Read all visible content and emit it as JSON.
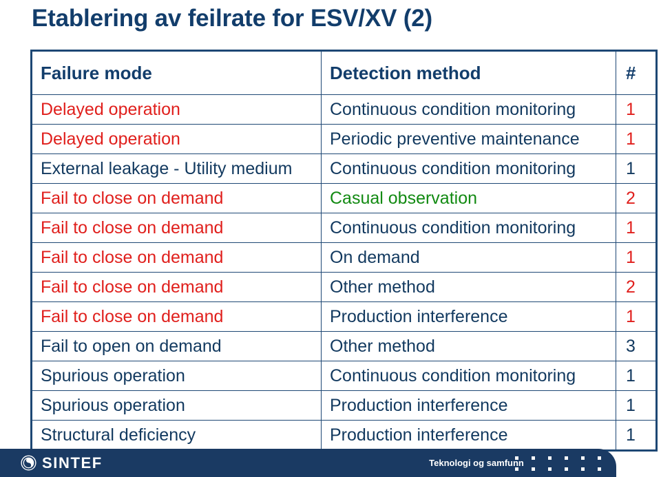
{
  "slide": {
    "title": "Etablering av feilrate for ESV/XV (2)",
    "title_color": "#123d6b"
  },
  "colors": {
    "navy": "#123d6b",
    "body_navy": "#12395f",
    "red": "#e01f1c",
    "green": "#128a12",
    "footer_bar": "#1a3a63",
    "border": "#1d4774"
  },
  "table": {
    "headers": {
      "failure_mode": "Failure mode",
      "detection_method": "Detection method",
      "count": "#"
    },
    "rows": [
      {
        "mode": "Delayed operation",
        "mode_color": "red",
        "method": "Continuous condition monitoring",
        "method_color": "blue",
        "count": "1",
        "count_color": "red"
      },
      {
        "mode": "Delayed operation",
        "mode_color": "red",
        "method": "Periodic preventive maintenance",
        "method_color": "blue",
        "count": "1",
        "count_color": "red"
      },
      {
        "mode": "External leakage - Utility medium",
        "mode_color": "blue",
        "method": "Continuous condition monitoring",
        "method_color": "blue",
        "count": "1",
        "count_color": "blue"
      },
      {
        "mode": "Fail to close on demand",
        "mode_color": "red",
        "method": "Casual observation",
        "method_color": "green",
        "count": "2",
        "count_color": "red"
      },
      {
        "mode": "Fail to close on demand",
        "mode_color": "red",
        "method": "Continuous condition monitoring",
        "method_color": "blue",
        "count": "1",
        "count_color": "red"
      },
      {
        "mode": "Fail to close on demand",
        "mode_color": "red",
        "method": "On demand",
        "method_color": "blue",
        "count": "1",
        "count_color": "red"
      },
      {
        "mode": "Fail to close on demand",
        "mode_color": "red",
        "method": "Other method",
        "method_color": "blue",
        "count": "2",
        "count_color": "red"
      },
      {
        "mode": "Fail to close on demand",
        "mode_color": "red",
        "method": "Production interference",
        "method_color": "blue",
        "count": "1",
        "count_color": "red"
      },
      {
        "mode": "Fail to open on demand",
        "mode_color": "blue",
        "method": "Other method",
        "method_color": "blue",
        "count": "3",
        "count_color": "blue"
      },
      {
        "mode": "Spurious operation",
        "mode_color": "blue",
        "method": "Continuous condition monitoring",
        "method_color": "blue",
        "count": "1",
        "count_color": "blue"
      },
      {
        "mode": "Spurious operation",
        "mode_color": "blue",
        "method": "Production interference",
        "method_color": "blue",
        "count": "1",
        "count_color": "blue"
      },
      {
        "mode": "Structural deficiency",
        "mode_color": "blue",
        "method": "Production interference",
        "method_color": "blue",
        "count": "1",
        "count_color": "blue"
      }
    ]
  },
  "footer": {
    "brand": "SINTEF",
    "tagline": "Teknologi og samfunn",
    "dot_count": 12
  }
}
